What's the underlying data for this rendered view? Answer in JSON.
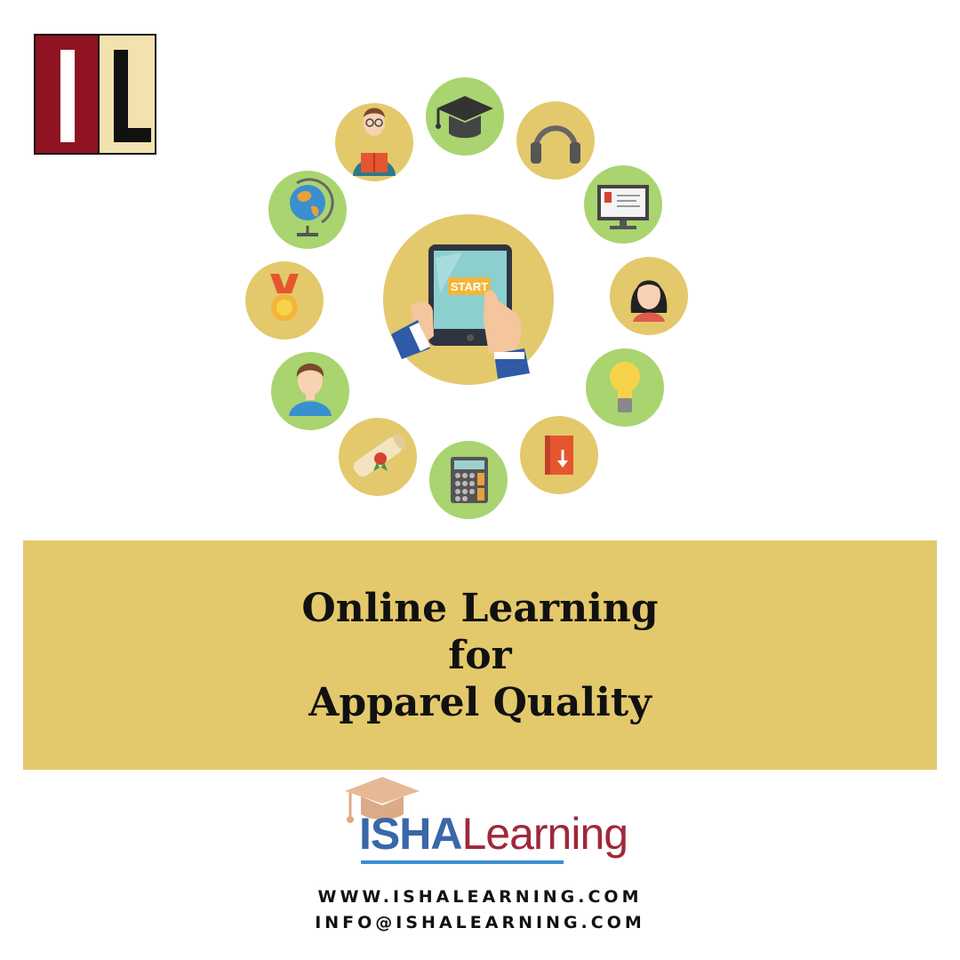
{
  "logo": {
    "letters": "IL"
  },
  "icon_ring": {
    "center_button": "START",
    "colors": {
      "gold": "#e3c96c",
      "green": "#a9d46f"
    },
    "items": [
      {
        "icon": "graduation-cap-icon",
        "bg": "green"
      },
      {
        "icon": "headphones-icon",
        "bg": "gold"
      },
      {
        "icon": "monitor-icon",
        "bg": "green"
      },
      {
        "icon": "woman-avatar-icon",
        "bg": "gold"
      },
      {
        "icon": "lightbulb-icon",
        "bg": "green"
      },
      {
        "icon": "book-download-icon",
        "bg": "gold"
      },
      {
        "icon": "calculator-icon",
        "bg": "green"
      },
      {
        "icon": "diploma-scroll-icon",
        "bg": "gold"
      },
      {
        "icon": "man-avatar-icon",
        "bg": "green"
      },
      {
        "icon": "medal-icon",
        "bg": "gold"
      },
      {
        "icon": "globe-icon",
        "bg": "green"
      },
      {
        "icon": "teacher-reading-icon",
        "bg": "gold"
      }
    ]
  },
  "banner": {
    "line1": "Online Learning",
    "line2": "for",
    "line3": "Apparel Quality"
  },
  "brand": {
    "isha": "ISHA",
    "learning": "Learning"
  },
  "contact": {
    "website": "WWW.ISHALEARNING.COM",
    "email": "INFO@ISHALEARNING.COM"
  }
}
